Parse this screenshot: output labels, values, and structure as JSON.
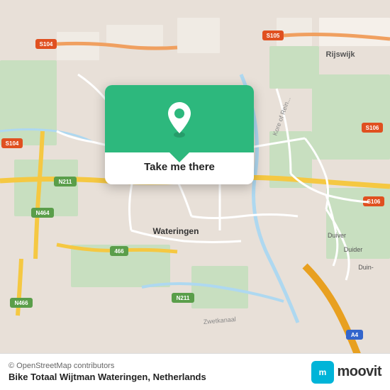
{
  "map": {
    "background_color": "#e8e0d8",
    "center_label": "Wateringen"
  },
  "popup": {
    "button_label": "Take me there",
    "accent_color": "#2db87d"
  },
  "footer": {
    "copyright": "© OpenStreetMap contributors",
    "location": "Bike Totaal Wijtman Wateringen, Netherlands",
    "logo_text": "moovit"
  }
}
